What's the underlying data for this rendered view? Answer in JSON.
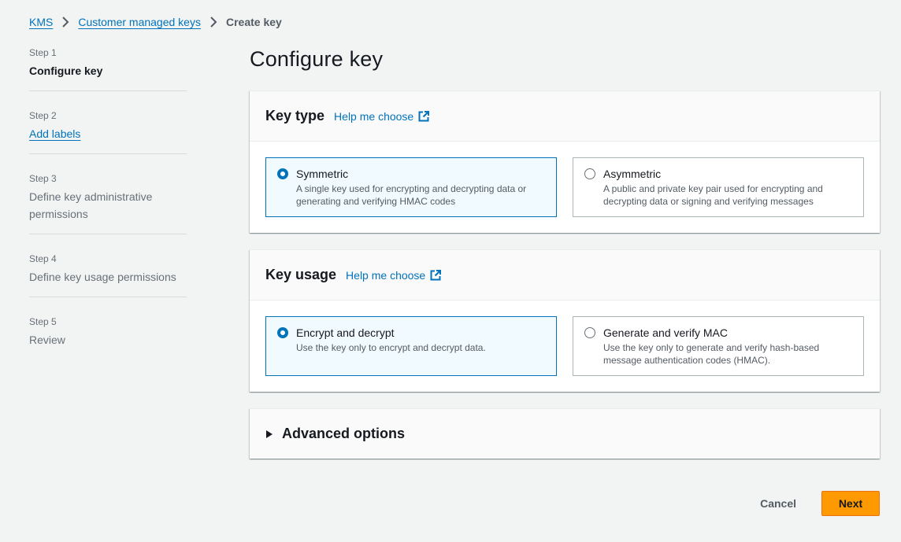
{
  "breadcrumb": {
    "items": [
      "KMS",
      "Customer managed keys"
    ],
    "current": "Create key"
  },
  "steps": [
    {
      "num": "Step 1",
      "title": "Configure key",
      "state": "current"
    },
    {
      "num": "Step 2",
      "title": "Add labels",
      "state": "link"
    },
    {
      "num": "Step 3",
      "title": "Define key administrative permissions",
      "state": "disabled"
    },
    {
      "num": "Step 4",
      "title": "Define key usage permissions",
      "state": "disabled"
    },
    {
      "num": "Step 5",
      "title": "Review",
      "state": "disabled"
    }
  ],
  "page_title": "Configure key",
  "key_type": {
    "title": "Key type",
    "help": "Help me choose",
    "options": [
      {
        "label": "Symmetric",
        "desc": "A single key used for encrypting and decrypting data or generating and verifying HMAC codes",
        "selected": true
      },
      {
        "label": "Asymmetric",
        "desc": "A public and private key pair used for encrypting and decrypting data or signing and verifying messages",
        "selected": false
      }
    ]
  },
  "key_usage": {
    "title": "Key usage",
    "help": "Help me choose",
    "options": [
      {
        "label": "Encrypt and decrypt",
        "desc": "Use the key only to encrypt and decrypt data.",
        "selected": true
      },
      {
        "label": "Generate and verify MAC",
        "desc": "Use the key only to generate and verify hash-based message authentication codes (HMAC).",
        "selected": false
      }
    ]
  },
  "advanced": {
    "title": "Advanced options",
    "icon": "caret-right-icon"
  },
  "actions": {
    "cancel": "Cancel",
    "next": "Next"
  },
  "colors": {
    "accent": "#0073bb",
    "primary_button": "#ff9900",
    "background": "#f2f3f3"
  }
}
